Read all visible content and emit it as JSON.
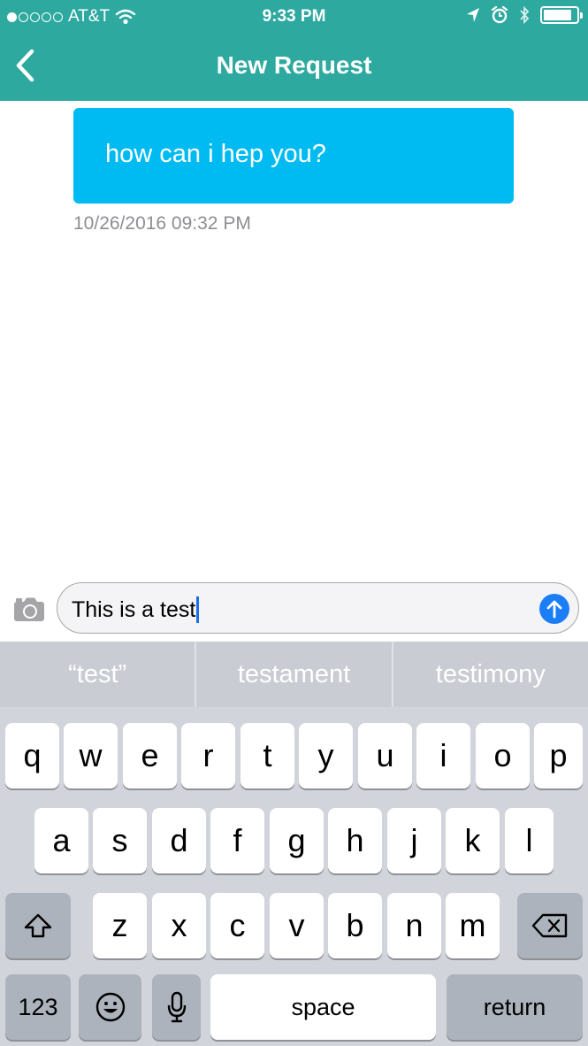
{
  "status_bar": {
    "carrier": "AT&T",
    "time": "9:33 PM",
    "battery_level": 0.85
  },
  "nav": {
    "title": "New Request",
    "back_icon": "chevron-left-icon"
  },
  "messages": [
    {
      "text": "how can i hep you?",
      "timestamp": "10/26/2016 09:32 PM"
    }
  ],
  "composer": {
    "value": "This is a test",
    "camera_icon": "camera-icon",
    "send_icon": "arrow-up-icon"
  },
  "keyboard": {
    "suggestions": [
      "“test”",
      "testament",
      "testimony"
    ],
    "row1": [
      "q",
      "w",
      "e",
      "r",
      "t",
      "y",
      "u",
      "i",
      "o",
      "p"
    ],
    "row2": [
      "a",
      "s",
      "d",
      "f",
      "g",
      "h",
      "j",
      "k",
      "l"
    ],
    "row3": [
      "z",
      "x",
      "c",
      "v",
      "b",
      "n",
      "m"
    ],
    "numbers_label": "123",
    "space_label": "space",
    "return_label": "return"
  },
  "colors": {
    "header": "#2ea9a0",
    "bubble": "#00bbf2",
    "send": "#1b7ef6"
  }
}
